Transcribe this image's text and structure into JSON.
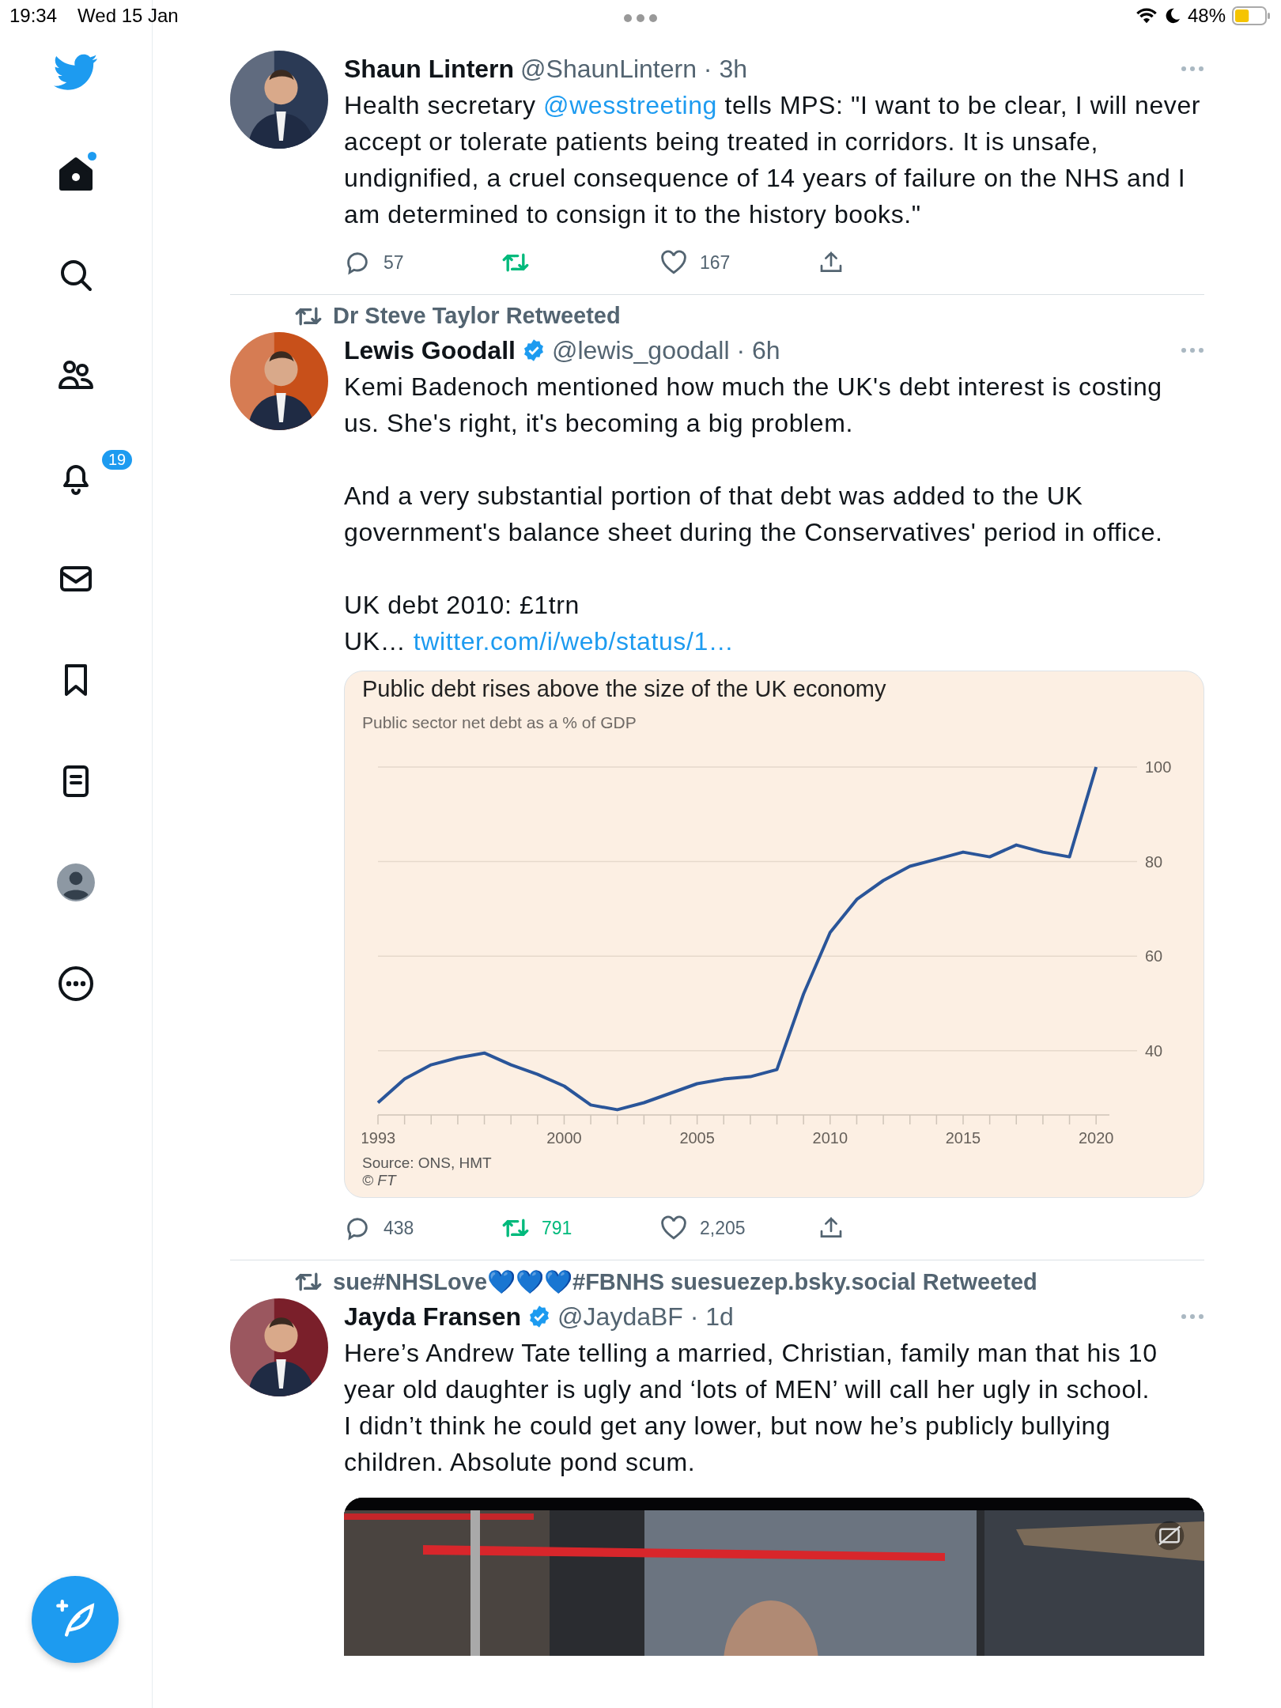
{
  "status_bar": {
    "time": "19:34",
    "date": "Wed 15 Jan",
    "battery": "48%"
  },
  "sidebar": {
    "items": [
      {
        "kind": "logo"
      },
      {
        "kind": "home",
        "selected": true,
        "unread": true
      },
      {
        "kind": "search",
        "selected": false
      },
      {
        "kind": "communities",
        "selected": false
      },
      {
        "kind": "notifications",
        "selected": false,
        "badge": "19"
      },
      {
        "kind": "messages",
        "selected": false
      },
      {
        "kind": "bookmarks",
        "selected": false
      },
      {
        "kind": "lists",
        "selected": false
      },
      {
        "kind": "profile",
        "selected": false
      },
      {
        "kind": "more",
        "selected": false
      }
    ]
  },
  "tweets": [
    {
      "name": "Shaun Lintern",
      "verified": false,
      "byline": "@ShaunLintern · 3h",
      "avatar": {
        "kind": "picture"
      },
      "body": [
        [
          {
            "kind": "text",
            "text": "Health secretary "
          },
          {
            "kind": "mention",
            "text": "@wesstreeting"
          },
          {
            "kind": "text",
            "text": " tells MPS: \"I want to be clear, I will never accept or tolerate patients being treated in corridors. It is unsafe, undignified, a cruel consequence of 14 years of failure on the NHS and I am determined to consign it to the history books.\""
          }
        ]
      ],
      "actions": {
        "replies": "57",
        "likes": "167",
        "retweeted": true,
        "liked": false
      }
    },
    {
      "retweeted_by": "Dr Steve Taylor Retweeted",
      "name": "Lewis Goodall",
      "verified": true,
      "byline": "@lewis_goodall · 6h",
      "avatar": {
        "kind": "picture"
      },
      "body": [
        [
          {
            "kind": "text",
            "text": "Kemi Badenoch mentioned how much the UK's debt interest is costing us. She's right, it's becoming a big problem."
          }
        ],
        [
          {
            "kind": "text",
            "text": "And a very substantial portion of that debt was added to the UK government's balance sheet during the Conservatives' period in office."
          }
        ],
        [
          {
            "kind": "text",
            "text": "UK debt 2010: £1trn\nUK… "
          },
          {
            "kind": "link",
            "text": "twitter.com/i/web/status/1…"
          }
        ]
      ],
      "media": {
        "kind": "chart",
        "title": "Public debt rises above the size of the UK economy",
        "subtitle": "Public sector net debt as a % of GDP",
        "source": "Source: ONS, HMT",
        "credit": "© FT",
        "chart_data": {
          "type": "line",
          "grid": true,
          "x": [
            1993,
            1994,
            1995,
            1996,
            1997,
            1998,
            1999,
            2000,
            2001,
            2002,
            2003,
            2004,
            2005,
            2006,
            2007,
            2008,
            2009,
            2010,
            2011,
            2012,
            2013,
            2014,
            2015,
            2016,
            2017,
            2018,
            2019,
            2020
          ],
          "series": [
            {
              "color": "#2a5599",
              "values": [
                29,
                34,
                37,
                38.5,
                39.5,
                37,
                35,
                32.5,
                28.5,
                27.5,
                29,
                31,
                33,
                34,
                34.5,
                36,
                52,
                65,
                72,
                76,
                79,
                80.5,
                82,
                81,
                83.5,
                82,
                81,
                100
              ]
            }
          ],
          "xlim": [
            1993,
            2020.5
          ],
          "ylim": [
            26.4,
            100
          ],
          "xticks": [
            1993,
            2000,
            2005,
            2010,
            2015,
            2020
          ],
          "yticks": [
            40,
            60,
            80,
            100
          ]
        }
      },
      "actions": {
        "replies": "438",
        "retweets": "791",
        "likes": "2,205",
        "retweeted": true,
        "liked": false
      }
    },
    {
      "retweeted_by": "sue#NHSLove💙💙💙#FBNHS suesuezep.bsky.social Retweeted",
      "name": "Jayda Fransen",
      "verified": true,
      "byline": "@JaydaBF · 1d",
      "avatar": {
        "kind": "picture"
      },
      "body": [
        [
          {
            "kind": "text",
            "text": "Here’s Andrew Tate telling a married, Christian, family man that his 10 year old daughter is ugly and ‘lots of MEN’ will call her ugly in school.\nI didn’t think he could get any lower, but now he’s publicly bullying children. Absolute pond scum."
          }
        ]
      ],
      "media": {
        "kind": "video",
        "captions": false
      }
    }
  ]
}
